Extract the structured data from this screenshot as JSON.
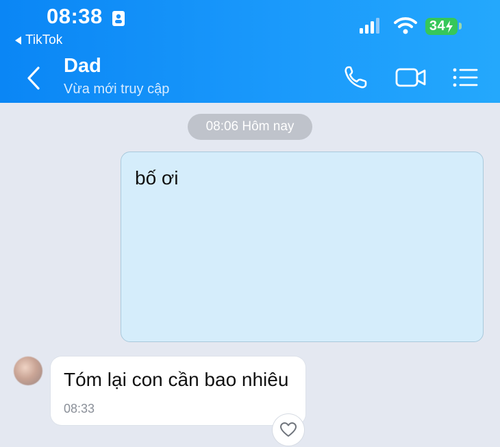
{
  "status_bar": {
    "time": "08:38",
    "back_app": "TikTok",
    "battery": "34"
  },
  "chat_header": {
    "name": "Dad",
    "status": "Vừa mới truy cập"
  },
  "messages": {
    "date_divider": "08:06 Hôm nay",
    "sent": [
      {
        "text": "bố ơi"
      }
    ],
    "received": [
      {
        "text": "Tóm lại con cần bao nhiêu",
        "time": "08:33"
      }
    ]
  },
  "icons": {
    "back": "chevron-left-icon",
    "call": "phone-icon",
    "video": "video-camera-icon",
    "menu": "menu-list-icon",
    "reaction": "heart-icon"
  },
  "colors": {
    "header": "#1a99fb",
    "sent_bubble": "#d5edfb",
    "received_bubble": "#ffffff",
    "battery": "#36c75a",
    "background": "#e4e8f1"
  }
}
